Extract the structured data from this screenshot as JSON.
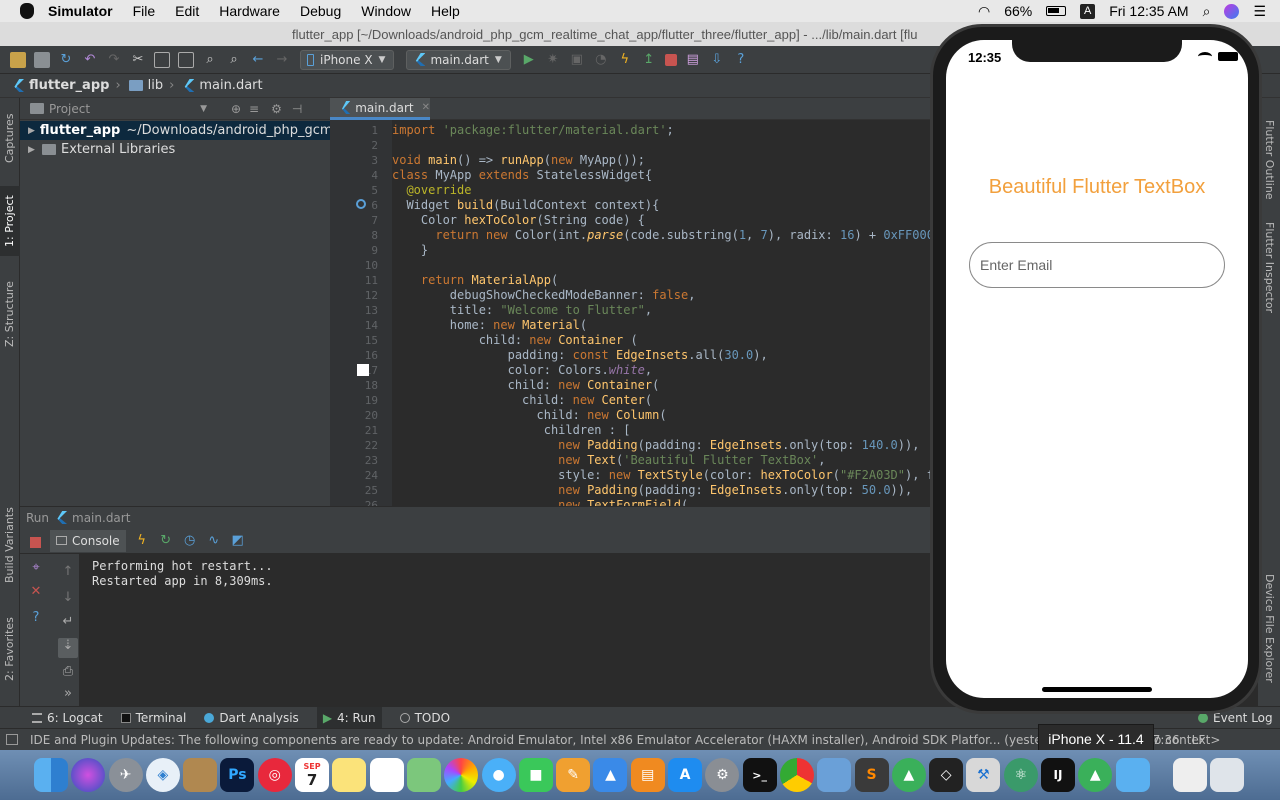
{
  "menubar": {
    "app_name": "Simulator",
    "items": [
      "File",
      "Edit",
      "Hardware",
      "Debug",
      "Window",
      "Help"
    ],
    "battery": "66%",
    "input_source": "A",
    "clock": "Fri 12:35 AM"
  },
  "window": {
    "title": "flutter_app [~/Downloads/android_php_gcm_realtime_chat_app/flutter_three/flutter_app] - .../lib/main.dart [flu"
  },
  "toolbar": {
    "device_selector": "iPhone X",
    "run_config": "main.dart"
  },
  "breadcrumb": {
    "project": "flutter_app",
    "folder": "lib",
    "file": "main.dart"
  },
  "left_strip": {
    "captures": "Captures",
    "project": "1: Project",
    "structure": "Z: Structure",
    "build_variants": "Build Variants",
    "favorites": "2: Favorites"
  },
  "project_panel": {
    "header": "Project",
    "rows": [
      {
        "name": "flutter_app",
        "path": "~/Downloads/android_php_gcm"
      },
      {
        "name": "External Libraries",
        "path": ""
      }
    ]
  },
  "editor": {
    "tab": "main.dart",
    "line_numbers": [
      "1",
      "2",
      "3",
      "4",
      "5",
      "6",
      "7",
      "8",
      "9",
      "10",
      "11",
      "12",
      "13",
      "14",
      "15",
      "16",
      "17",
      "18",
      "19",
      "20",
      "21",
      "22",
      "23",
      "24",
      "25",
      "26"
    ]
  },
  "run_panel": {
    "header_label": "Run",
    "header_config": "main.dart",
    "console_tab": "Console",
    "console_lines": [
      "Performing hot restart...",
      "Restarted app in 8,309ms."
    ]
  },
  "bottom_tabs": {
    "logcat": "6: Logcat",
    "terminal": "Terminal",
    "dart_analysis": "Dart Analysis",
    "run": "4: Run",
    "todo": "TODO",
    "event_log": "Event Log"
  },
  "status_bar": {
    "message": "IDE and Plugin Updates: The following components are ready to update: Android Emulator, Intel x86 Emulator Accelerator (HAXM installer), Android SDK Platfor... (yesterday 11:28 PM)",
    "position": "17:36",
    "line_sep": "LF",
    "context": "o context>"
  },
  "right_strip": {
    "outline": "Flutter Outline",
    "inspector": "Flutter Inspector",
    "device_explorer": "Device File Explorer"
  },
  "simulator": {
    "time": "12:35",
    "app_title": "Beautiful Flutter TextBox",
    "email_placeholder": "Enter Email",
    "device_tooltip": "iPhone X - 11.4",
    "title_color": "#F2A03D"
  },
  "dock": {
    "calendar_month": "SEP",
    "calendar_day": "7"
  }
}
